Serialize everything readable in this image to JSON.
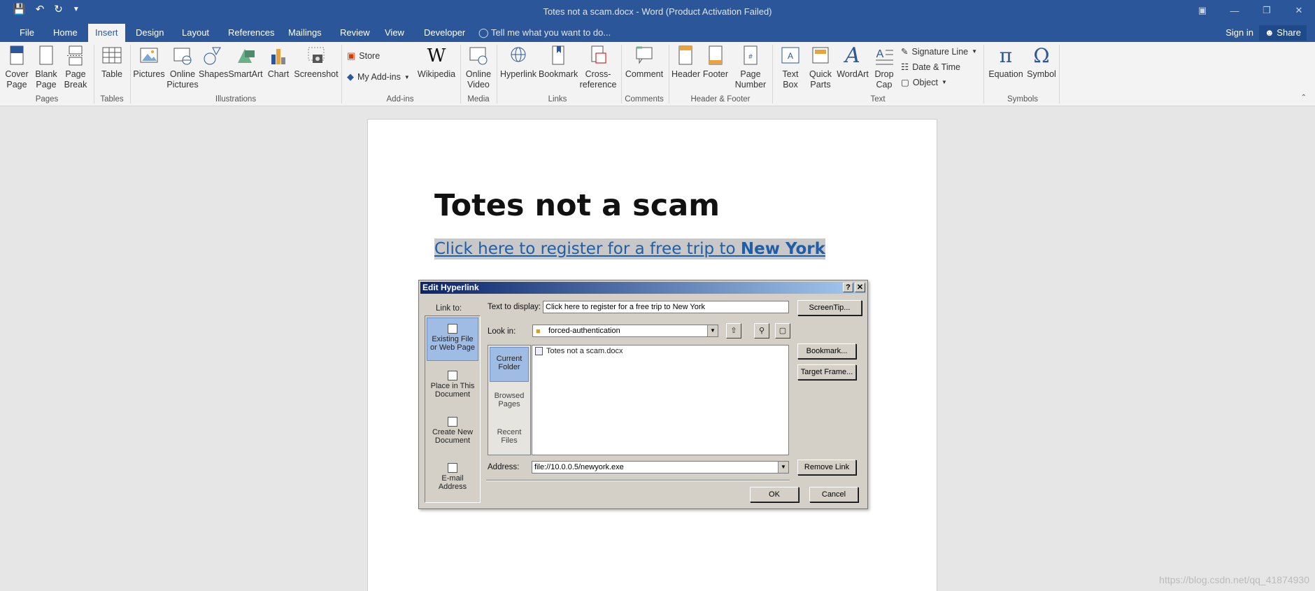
{
  "window": {
    "title": "Totes not a scam.docx - Word (Product Activation Failed)",
    "qat_icons": [
      "save-icon",
      "undo-icon",
      "redo-icon",
      "customize-icon"
    ]
  },
  "tabs": {
    "items": [
      "File",
      "Home",
      "Insert",
      "Design",
      "Layout",
      "References",
      "Mailings",
      "Review",
      "View",
      "Developer"
    ],
    "active": "Insert",
    "tell_me": "Tell me what you want to do...",
    "sign_in": "Sign in",
    "share": "Share"
  },
  "ribbon": {
    "cover_page": "Cover\nPage",
    "blank_page": "Blank\nPage",
    "page_break": "Page\nBreak",
    "pages_group": "Pages",
    "table": "Table",
    "tables_group": "Tables",
    "pictures": "Pictures",
    "online_pictures": "Online\nPictures",
    "shapes": "Shapes",
    "smartart": "SmartArt",
    "chart": "Chart",
    "screenshot": "Screenshot",
    "illustrations_group": "Illustrations",
    "store": "Store",
    "my_addins": "My Add-ins",
    "wikipedia": "Wikipedia",
    "addins_group": "Add-ins",
    "online_video": "Online\nVideo",
    "media_group": "Media",
    "hyperlink": "Hyperlink",
    "bookmark": "Bookmark",
    "cross_reference": "Cross-\nreference",
    "links_group": "Links",
    "comment": "Comment",
    "comments_group": "Comments",
    "header": "Header",
    "footer": "Footer",
    "page_number": "Page\nNumber",
    "header_footer_group": "Header & Footer",
    "text_box": "Text\nBox",
    "quick_parts": "Quick\nParts",
    "wordart": "WordArt",
    "drop_cap": "Drop\nCap",
    "signature_line": "Signature Line",
    "date_time": "Date & Time",
    "object": "Object",
    "text_group": "Text",
    "equation": "Equation",
    "symbol": "Symbol",
    "symbols_group": "Symbols"
  },
  "document": {
    "title": "Totes not a scam",
    "link_text_plain": "Click here to register for a free trip to ",
    "link_text_bold": "New York"
  },
  "dialog": {
    "title": "Edit Hyperlink",
    "link_to_label": "Link to:",
    "link_options": [
      "Existing File\nor Web Page",
      "Place in This\nDocument",
      "Create New\nDocument",
      "E-mail\nAddress"
    ],
    "text_to_display_label": "Text to display:",
    "text_to_display_value": "Click here to register for a free trip to New York",
    "screentip_button": "ScreenTip...",
    "look_in_label": "Look in:",
    "look_in_value": "forced-authentication",
    "nav_items": [
      "Current\nFolder",
      "Browsed\nPages",
      "Recent\nFiles"
    ],
    "files": [
      "Totes not a scam.docx"
    ],
    "bookmark_button": "Bookmark...",
    "target_frame_button": "Target Frame...",
    "address_label": "Address:",
    "address_value": "file://10.0.0.5/newyork.exe",
    "remove_link_button": "Remove Link",
    "ok_button": "OK",
    "cancel_button": "Cancel"
  },
  "watermark": "https://blog.csdn.net/qq_41874930",
  "colors": {
    "accent": "#2b579a",
    "link": "#1f5ea8",
    "dialog_bg": "#d4d0c8",
    "selection": "#9fbce5"
  }
}
